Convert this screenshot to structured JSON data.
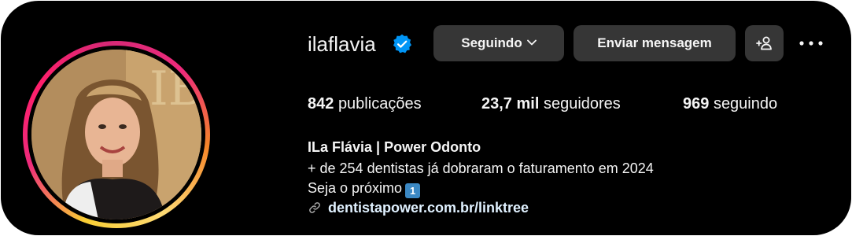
{
  "profile": {
    "username": "ilaflavia",
    "verified": true
  },
  "actions": {
    "following_label": "Seguindo",
    "message_label": "Enviar mensagem",
    "add_user_icon": "add-user-icon",
    "more_icon": "more-options-icon"
  },
  "stats": {
    "posts_count": "842",
    "posts_label": "publicações",
    "followers_count": "23,7 mil",
    "followers_label": "seguidores",
    "following_count": "969",
    "following_label": "seguindo"
  },
  "bio": {
    "name": "ILa Flávia | Power Odonto",
    "line1": "+ de 254 dentistas já dobraram o faturamento em 2024",
    "line2": "Seja o próximo",
    "line2_emoji": "1",
    "link": "dentistapower.com.br/linktree"
  },
  "colors": {
    "background": "#000000",
    "button": "#363636",
    "verified": "#0095f6",
    "link": "#e0f1ff"
  }
}
